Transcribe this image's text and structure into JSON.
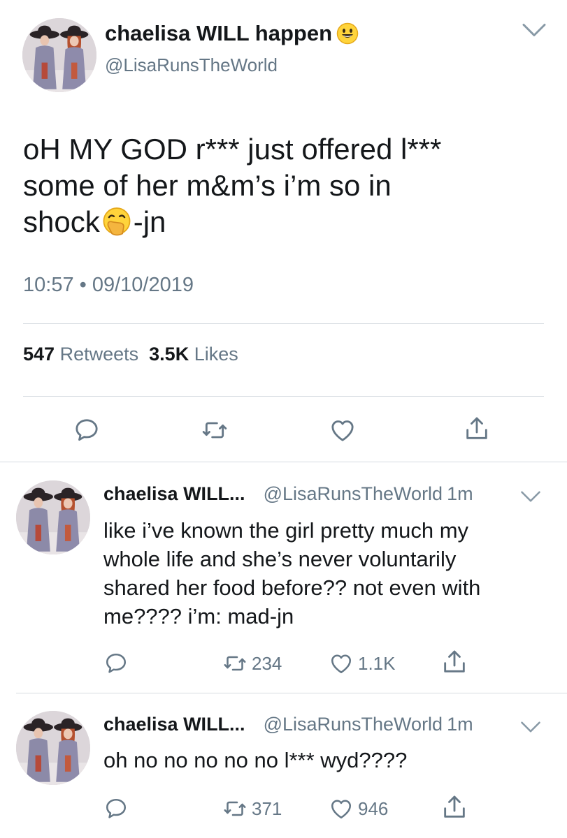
{
  "tweet": {
    "display_name": "chaelisa WILL happen",
    "handle": "@LisaRunsTheWorld",
    "text_line1": "oH MY GOD r*** just offered l***",
    "text_line2": "some of her m&m’s i’m so in",
    "text_line3_a": "shock",
    "text_line3_b": "-jn",
    "timestamp": "10:57 • 09/10/2019",
    "retweets_count": "547",
    "retweets_label": "Retweets",
    "likes_count": "3.5K",
    "likes_label": "Likes"
  },
  "replies": [
    {
      "name": "chaelisa WILL...",
      "handle": "@LisaRunsTheWorld",
      "time": "1m",
      "lines": [
        "like i’ve known the girl pretty much my",
        "whole life and she’s never voluntarily",
        "shared her food before?? not even with",
        "me???? i’m: mad-jn"
      ],
      "retweets": "234",
      "likes": "1.1K"
    },
    {
      "name": "chaelisa WILL...",
      "handle": "@LisaRunsTheWorld",
      "time": "1m",
      "lines": [
        "oh no no no no no l*** wyd????"
      ],
      "retweets": "371",
      "likes": "946"
    }
  ],
  "icons": {
    "reply": "speech-bubble-icon",
    "retweet": "retweet-icon",
    "like": "heart-icon",
    "share": "share-icon",
    "more": "chevron-down-icon",
    "name_emoji": "smiley-emoji",
    "text_emoji": "hand-over-mouth-emoji"
  },
  "colors": {
    "text": "#14171a",
    "secondary": "#657786",
    "divider": "#d6dbe0"
  }
}
